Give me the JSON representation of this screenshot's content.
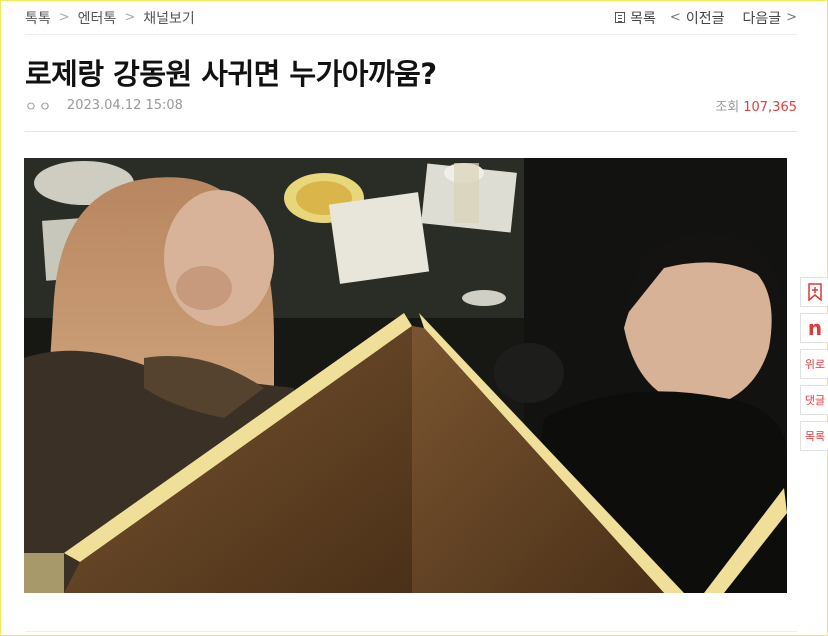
{
  "breadcrumb": [
    "톡톡",
    "엔터톡",
    "채널보기"
  ],
  "nav": {
    "list_label": "목록",
    "prev_label": "이전글",
    "next_label": "다음글"
  },
  "post": {
    "title": "로제랑 강동원 사귀면 누가아까움?",
    "author": "ㅇㅇ",
    "datetime": "2023.04.12 15:08",
    "views_label": "조회",
    "views_count": "107,365"
  },
  "side_tools": {
    "bookmark_icon": "bookmark-plus-icon",
    "naver_label": "n",
    "up_label": "위로",
    "comments_label": "댓글",
    "list_label": "목록"
  },
  "colors": {
    "accent": "#e03a3a",
    "views_red": "#e04040",
    "frame_border": "#f2ea5a"
  }
}
